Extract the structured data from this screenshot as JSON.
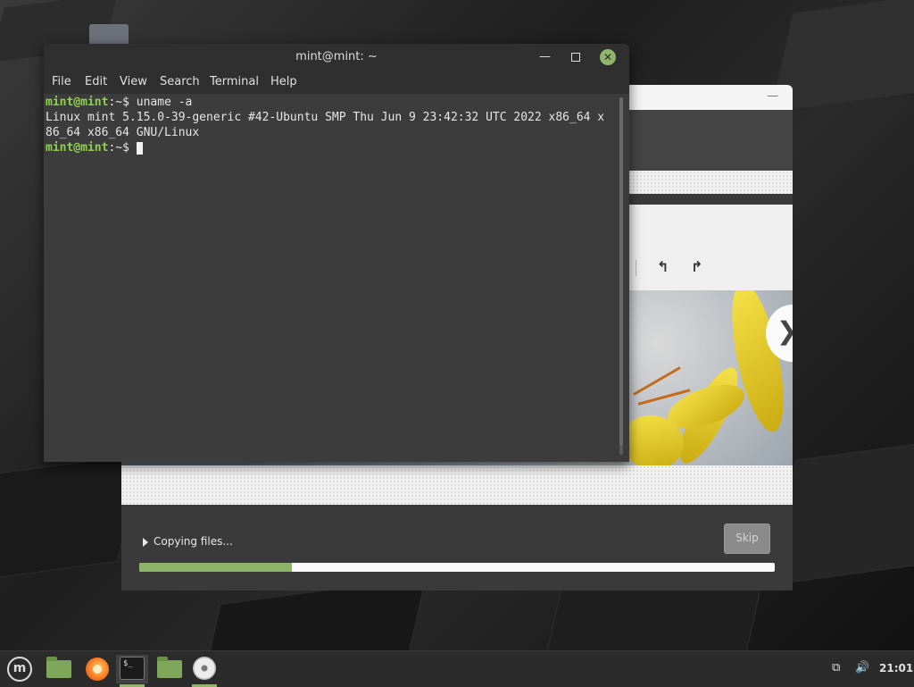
{
  "terminal": {
    "title": "mint@mint: ~",
    "menu": [
      "File",
      "Edit",
      "View",
      "Search",
      "Terminal",
      "Help"
    ],
    "lines": [
      {
        "prompt": "mint@mint",
        "sep": ":~$ ",
        "cmd": "uname -a"
      },
      {
        "text": "Linux mint 5.15.0-39-generic #42-Ubuntu SMP Thu Jun 9 23:42:32 UTC 2022 x86_64 x"
      },
      {
        "text": "86_64 x86_64 GNU/Linux"
      },
      {
        "prompt": "mint@mint",
        "sep": ":~$ ",
        "cmd": ""
      }
    ],
    "buttons": {
      "minimize": "—",
      "close": "✕"
    }
  },
  "installer": {
    "status_text": "Copying files...",
    "skip_label": "Skip",
    "progress_pct": 24,
    "next_symbol": "❯",
    "undo_symbol": "↰",
    "redo_symbol": "↱",
    "min_symbol": "—"
  },
  "taskbar": {
    "menu_symbol": "m",
    "terminal_symbol": "$_",
    "clock": "21:01",
    "network_symbol": "⧉",
    "volume_symbol": "🔊"
  },
  "colors": {
    "accent": "#8fb46a",
    "prompt": "#8fd14f",
    "progress": "#8eb469"
  }
}
